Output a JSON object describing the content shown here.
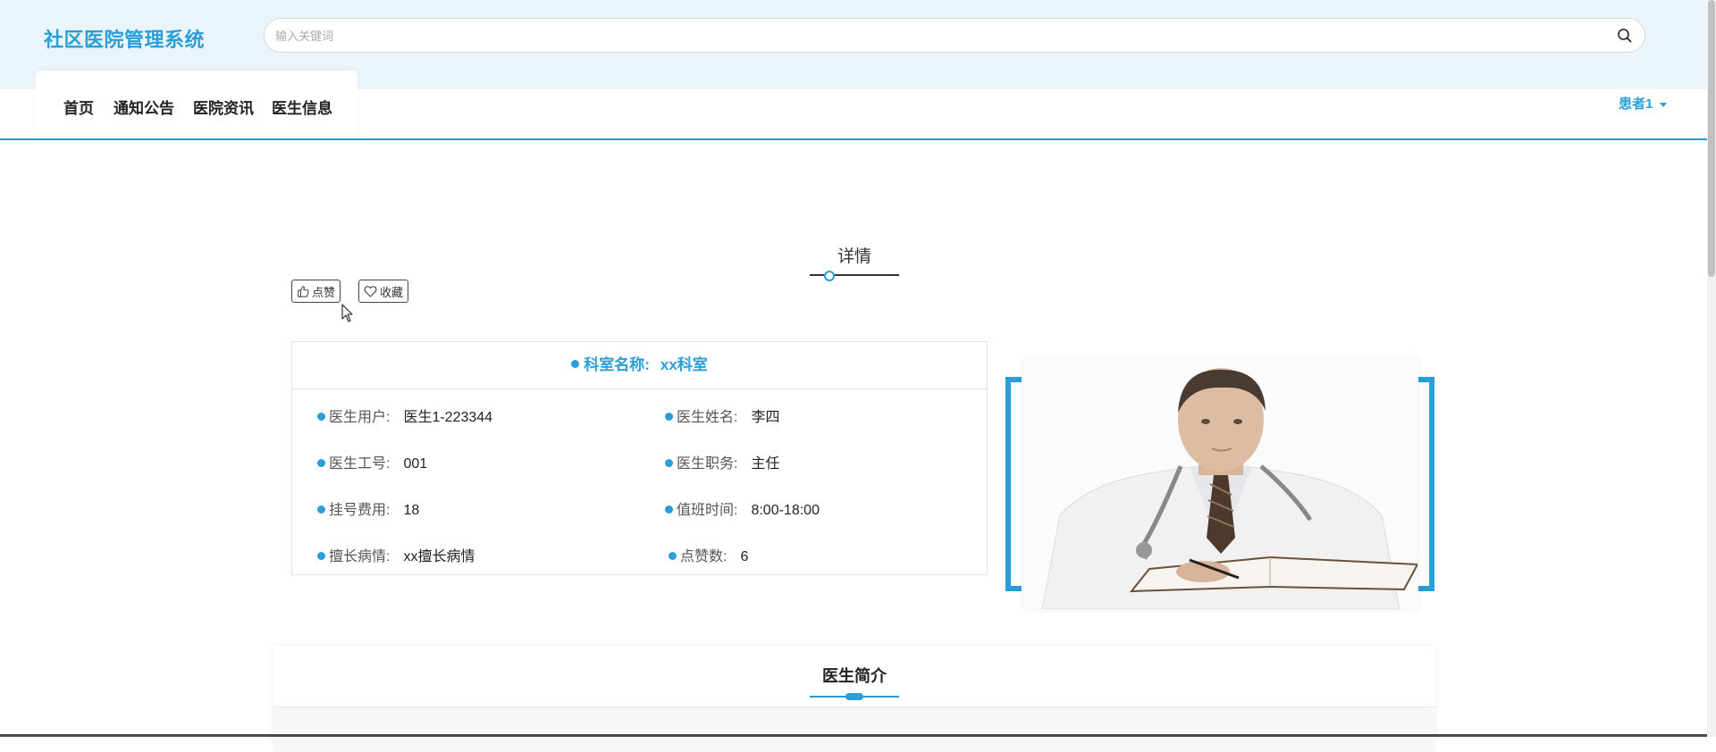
{
  "header": {
    "logo": "社区医院管理系统",
    "search": {
      "placeholder": "输入关键词",
      "value": ""
    },
    "nav": [
      {
        "label": "首页"
      },
      {
        "label": "通知公告"
      },
      {
        "label": "医院资讯"
      },
      {
        "label": "医生信息"
      }
    ],
    "user": "患者1"
  },
  "detail": {
    "title": "详情",
    "like_label": "点赞",
    "favorite_label": "收藏",
    "dept": {
      "label": "科室名称:",
      "value": "xx科室"
    },
    "fields": [
      {
        "label": "医生用户:",
        "value": "医生1-223344"
      },
      {
        "label": "医生姓名:",
        "value": "李四"
      },
      {
        "label": "医生工号:",
        "value": "001"
      },
      {
        "label": "医生职务:",
        "value": "主任"
      },
      {
        "label": "挂号费用:",
        "value": "18"
      },
      {
        "label": "值班时间:",
        "value": "8:00-18:00"
      },
      {
        "label": "擅长病情:",
        "value": "xx擅长病情"
      },
      {
        "label": "点赞数:",
        "value": "6"
      }
    ]
  },
  "intro": {
    "title": "医生简介"
  },
  "colors": {
    "accent": "#2a9ed9",
    "header_bg": "#eaf4fb"
  }
}
